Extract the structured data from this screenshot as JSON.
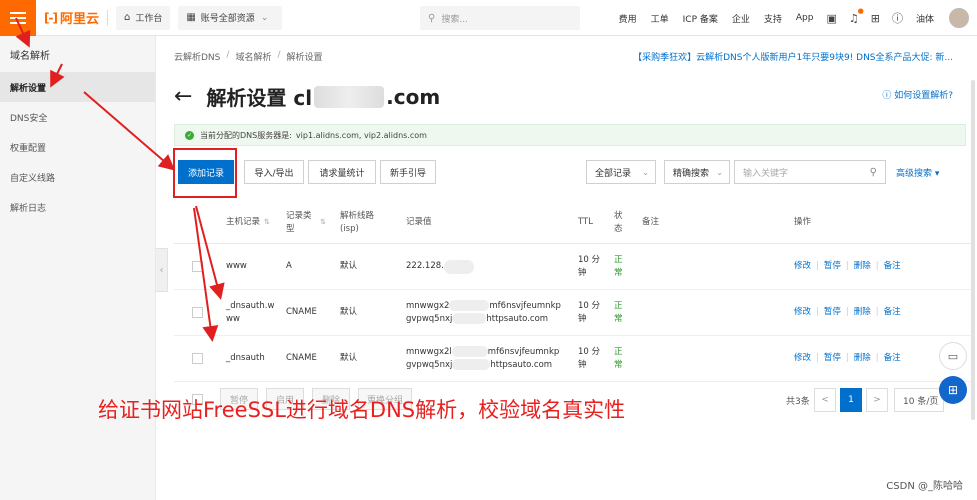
{
  "topbar": {
    "logo": "阿里云",
    "logo_mark": "[-]",
    "workbench": "工作台",
    "account_scope": "账号全部资源",
    "search_placeholder": "搜索...",
    "links": [
      "费用",
      "工单",
      "ICP 备案",
      "企业",
      "支持",
      "App"
    ],
    "user": "油体"
  },
  "sidebar": {
    "title": "域名解析",
    "items": [
      "解析设置",
      "DNS安全",
      "权重配置",
      "自定义线路",
      "解析日志"
    ]
  },
  "breadcrumb": [
    "云解析DNS",
    "域名解析",
    "解析设置"
  ],
  "promo": "【采购季狂欢】云解析DNS个人版新用户1年只要9块9! DNS全系产品大促: 新...",
  "page": {
    "title_prefix": "解析设置 cl",
    "title_suffix": ".com",
    "help": "如何设置解析?"
  },
  "notice": {
    "label": "当前分配的DNS服务器是:",
    "servers": "vip1.alidns.com, vip2.alidns.com"
  },
  "toolbar": {
    "add_record": "添加记录",
    "import_export": "导入/导出",
    "request_stats": "请求量统计",
    "guide": "新手引导",
    "record_filter": "全部记录",
    "search_type": "精确搜索",
    "keyword_placeholder": "输入关键字",
    "advanced": "高级搜索"
  },
  "table": {
    "headers": {
      "host": "主机记录",
      "type": "记录类型",
      "line": "解析线路(isp)",
      "value": "记录值",
      "ttl": "TTL",
      "status": "状态",
      "remark": "备注",
      "actions": "操作"
    },
    "action_labels": [
      "修改",
      "暂停",
      "删除",
      "备注"
    ],
    "rows": [
      {
        "host": "www",
        "type": "A",
        "line": "默认",
        "value_a": "222.128.",
        "value_b": "",
        "ttl": "10 分钟",
        "status": "正常"
      },
      {
        "host": "_dnsauth.www",
        "type": "CNAME",
        "line": "默认",
        "value_a": "mnwwgx2",
        "value_a2": "mf6nsvjfeumnkp",
        "value_b": "gvpwq5nxj",
        "value_b2": "httpsauto.com",
        "ttl": "10 分钟",
        "status": "正常"
      },
      {
        "host": "_dnsauth",
        "type": "CNAME",
        "line": "默认",
        "value_a": "mnwwgx2l",
        "value_a2": "mf6nsvjfeumnkp",
        "value_b": "gvpwq5nxj",
        "value_b2": "httpsauto.com",
        "ttl": "10 分钟",
        "status": "正常"
      }
    ]
  },
  "bulk": [
    "暂停",
    "启用",
    "删除",
    "更换分组"
  ],
  "pager": {
    "total": "共3条",
    "current": "1",
    "prev": "<",
    "next": ">",
    "page_size": "10 条/页"
  },
  "caption": "给证书网站FreeSSL进行域名DNS解析，校验域名真实性",
  "watermark": "CSDN @_陈哈哈",
  "colors": {
    "brand": "#ff6a00",
    "primary": "#0070cc",
    "annotation": "#e02020"
  }
}
